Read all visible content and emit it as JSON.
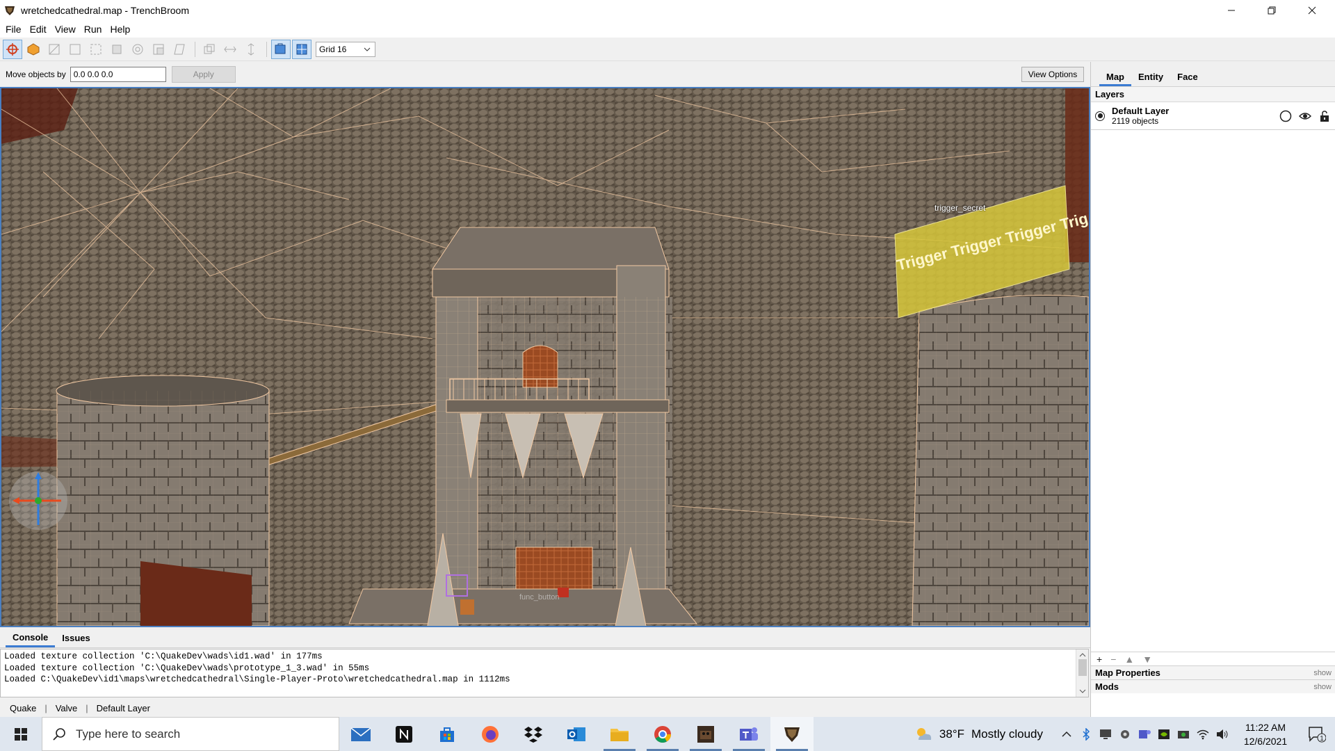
{
  "window": {
    "title": "wretchedcathedral.map - TrenchBroom"
  },
  "menu": [
    "File",
    "Edit",
    "View",
    "Run",
    "Help"
  ],
  "toolbar": {
    "grid_value": "Grid 16"
  },
  "move_bar": {
    "label": "Move objects by",
    "input_value": "0.0 0.0 0.0",
    "apply_label": "Apply",
    "view_options_label": "View Options"
  },
  "viewport": {
    "entity_label": "trigger_secret",
    "trigger_text": "Trigger Trigger Trigger Trig",
    "entity_label_2": "func_button"
  },
  "right_panel": {
    "tabs": [
      "Map",
      "Entity",
      "Face"
    ],
    "active_tab": "Map",
    "layers_title": "Layers",
    "layer": {
      "name": "Default Layer",
      "count": "2119 objects"
    },
    "mini_toolbar": [
      "+",
      "−",
      "▲",
      "▼"
    ],
    "map_properties": "Map Properties",
    "mods": "Mods",
    "show": "show"
  },
  "console": {
    "tabs": [
      "Console",
      "Issues"
    ],
    "lines": [
      "Loaded texture collection 'C:\\QuakeDev\\wads\\id1.wad' in 177ms",
      "Loaded texture collection 'C:\\QuakeDev\\wads\\prototype_1_3.wad' in 55ms",
      "Loaded C:\\QuakeDev\\id1\\maps\\wretchedcathedral\\Single-Player-Proto\\wretchedcathedral.map in 1112ms"
    ]
  },
  "status": {
    "game": "Quake",
    "format": "Valve",
    "layer": "Default Layer"
  },
  "taskbar": {
    "search_placeholder": "Type here to search",
    "weather_temp": "38°F",
    "weather_desc": "Mostly cloudy",
    "time": "11:22 AM",
    "date": "12/6/2021",
    "notification_count": "1"
  },
  "colors": {
    "accent": "#3b7bd2",
    "viewport_border": "#4a7fc1",
    "trigger_fill": "#d6c63a",
    "wireframe": "#f2c9a3"
  }
}
